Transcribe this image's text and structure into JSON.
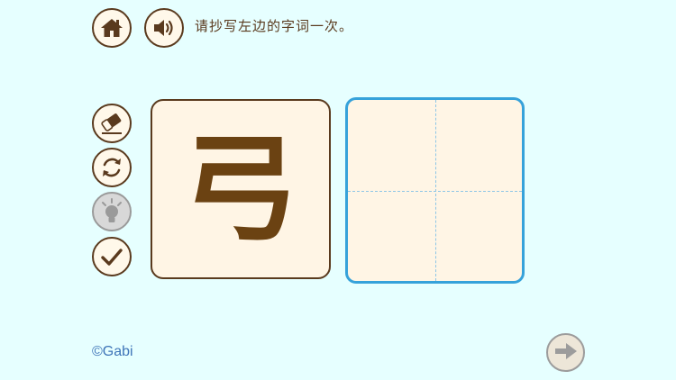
{
  "header": {
    "instruction": "请抄写左边的字词一次。"
  },
  "icons": {
    "home": "home-icon",
    "sound": "speaker-icon",
    "eraser": "eraser-icon",
    "reset": "refresh-icon",
    "hint": "lightbulb-icon",
    "check": "checkmark-icon",
    "next": "arrow-right-icon"
  },
  "model": {
    "character": "弓"
  },
  "footer": {
    "copyright": "©Gabi"
  },
  "colors": {
    "background": "#E6FFFF",
    "brown": "#5A3A1E",
    "grid_border": "#36A2DA",
    "card_fill": "#FFF5E5",
    "copyright_blue": "#3E74B8"
  }
}
